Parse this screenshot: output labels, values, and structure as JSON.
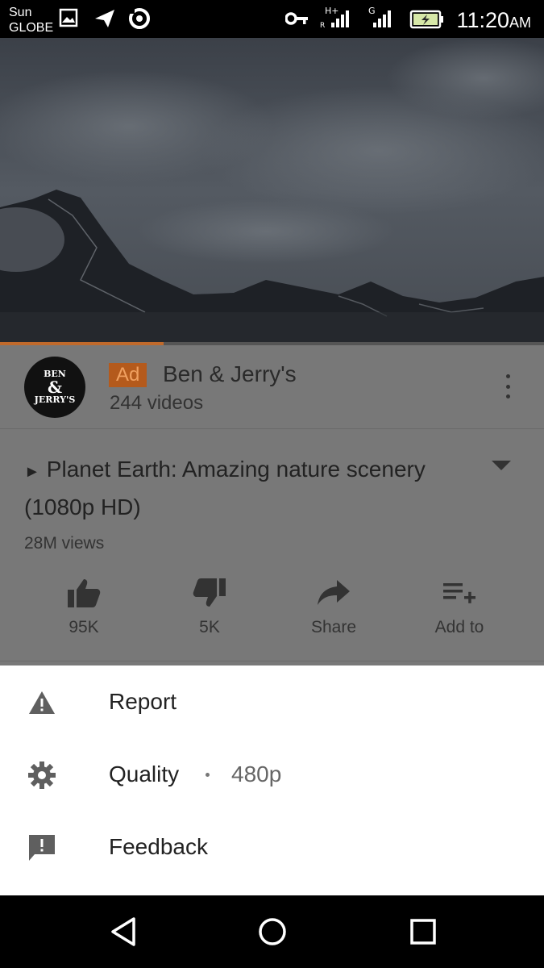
{
  "status_bar": {
    "carrier_line1": "Sun",
    "carrier_line2": "GLOBE",
    "time": "11:20",
    "ampm": "AM",
    "icons": [
      "image-icon",
      "send-icon",
      "sync-icon",
      "vpn-key-icon",
      "signal-h-icon",
      "signal-g-icon",
      "battery-charging-icon"
    ]
  },
  "video": {
    "description": "",
    "progress": 0.3
  },
  "channel": {
    "ad_label": "Ad",
    "name": "Ben & Jerry's",
    "video_count": "244 videos",
    "avatar_text": "BEN & JERRY'S"
  },
  "video_info": {
    "title": "Planet Earth: Amazing nature scenery (1080p HD)",
    "views": "28M views"
  },
  "actions": [
    {
      "label": "95K",
      "icon": "thumbs-up-icon"
    },
    {
      "label": "5K",
      "icon": "thumbs-down-icon"
    },
    {
      "label": "Share",
      "icon": "share-icon"
    },
    {
      "label": "Add to",
      "icon": "playlist-add-icon"
    }
  ],
  "menu": {
    "items": [
      {
        "label": "Report",
        "icon": "warning-icon"
      },
      {
        "label": "Quality",
        "value": "480p",
        "icon": "gear-icon"
      },
      {
        "label": "Feedback",
        "icon": "feedback-icon"
      }
    ]
  },
  "colors": {
    "accent_orange": "#b45a1c",
    "overlay_gray": "#787878",
    "sheet_bg": "#ffffff"
  }
}
